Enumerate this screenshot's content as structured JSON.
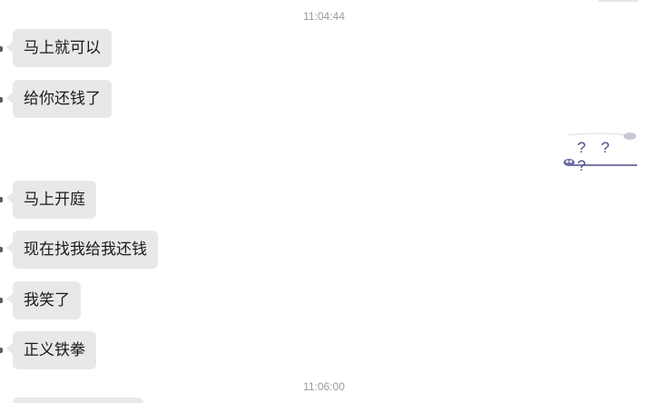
{
  "chat": {
    "timestamps": [
      "11:04:44",
      "11:06:00"
    ],
    "messages": [
      {
        "side": "left",
        "text": "马上就可以"
      },
      {
        "side": "left",
        "text": "给你还钱了"
      },
      {
        "side": "right",
        "type": "sticker",
        "text": "? ? ?"
      },
      {
        "side": "left",
        "text": "马上开庭"
      },
      {
        "side": "left",
        "text": "现在找我给我还钱"
      },
      {
        "side": "left",
        "text": "我笑了"
      },
      {
        "side": "left",
        "text": "正义铁拳"
      }
    ]
  },
  "colors": {
    "bubble_left": "#e8e8e8",
    "timestamp": "#9a9a9a",
    "sticker_text": "#4d4c8a"
  }
}
